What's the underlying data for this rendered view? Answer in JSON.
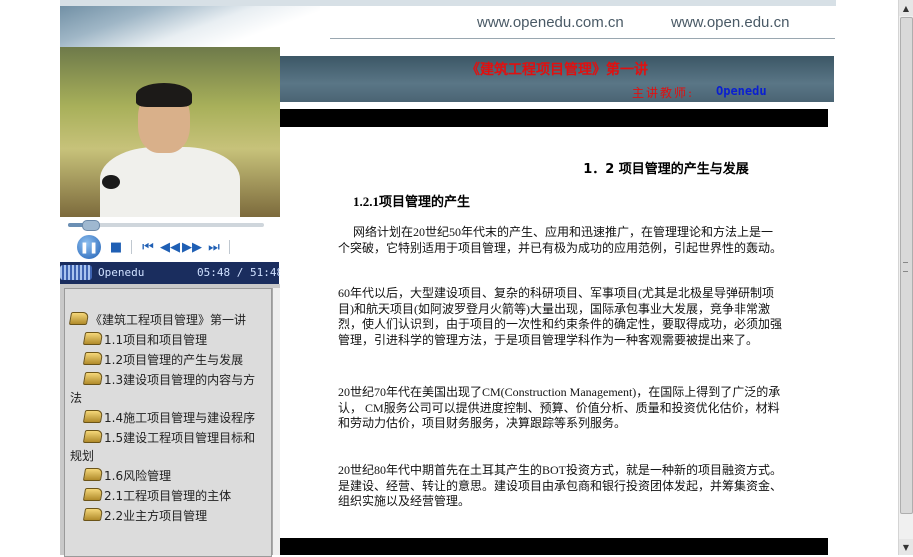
{
  "banner": {
    "url_1": "www.openedu.com.cn",
    "url_2": "www.open.edu.cn"
  },
  "player": {
    "status_name": "Openedu",
    "current_time": "05:48",
    "total_time": "51:48",
    "time_display": "05:48 / 51:48",
    "progress": 0.11,
    "controls": {
      "pause": "pause-icon",
      "stop": "stop-icon",
      "prev": "skip-back-icon",
      "rewind": "rewind-icon",
      "fast_forward": "fast-forward-icon",
      "next": "skip-forward-icon"
    }
  },
  "toc": {
    "root": "《建筑工程项目管理》第一讲",
    "items": [
      "1.1项目和项目管理",
      "1.2项目管理的产生与发展",
      "1.3建设项目管理的内容与方法",
      "1.4施工项目管理与建设程序",
      "1.5建设工程项目管理目标和规划",
      "1.6风险管理",
      "2.1工程项目管理的主体",
      "2.2业主方项目管理"
    ]
  },
  "lecture": {
    "title": "《建筑工程项目管理》第一讲",
    "lecturer_label": "主讲教师:",
    "lecturer_name": "Openedu"
  },
  "content": {
    "heading": "1．2 项目管理的产生与发展",
    "subheading": "1.2.1项目管理的产生",
    "paragraphs": [
      "网络计划在20世纪50年代末的产生、应用和迅速推广，在管理理论和方法上是一个突破，它特别适用于项目管理，并已有极为成功的应用范例，引起世界性的轰动。",
      "60年代以后，大型建设项目、复杂的科研项目、军事项目(尤其是北极星导弹研制项目)和航天项目(如阿波罗登月火箭等)大量出现，国际承包事业大发展，竞争非常激烈，使人们认识到，由于项目的一次性和约束条件的确定性，要取得成功，必须加强管理，引进科学的管理方法，于是项目管理学科作为一种客观需要被提出来了。",
      "20世纪70年代在美国出现了CM(Construction Management)，在国际上得到了广泛的承认，      CM服务公司可以提供进度控制、预算、价值分析、质量和投资优化估价，材料和劳动力估价，项目财务服务，决算跟踪等系列服务。",
      "20世纪80年代中期首先在土耳其产生的BOT投资方式，就是一种新的项目融资方式。是建设、经营、转让的意思。建设项目由承包商和银行投资团体发起，并筹集资金、组织实施以及经营管理。"
    ]
  },
  "colors": {
    "title_red": "#e01010",
    "lecturer_blue": "#0a1fd0",
    "status_bar_bg": "#1a2d5e",
    "header_band": "#4a6473"
  }
}
